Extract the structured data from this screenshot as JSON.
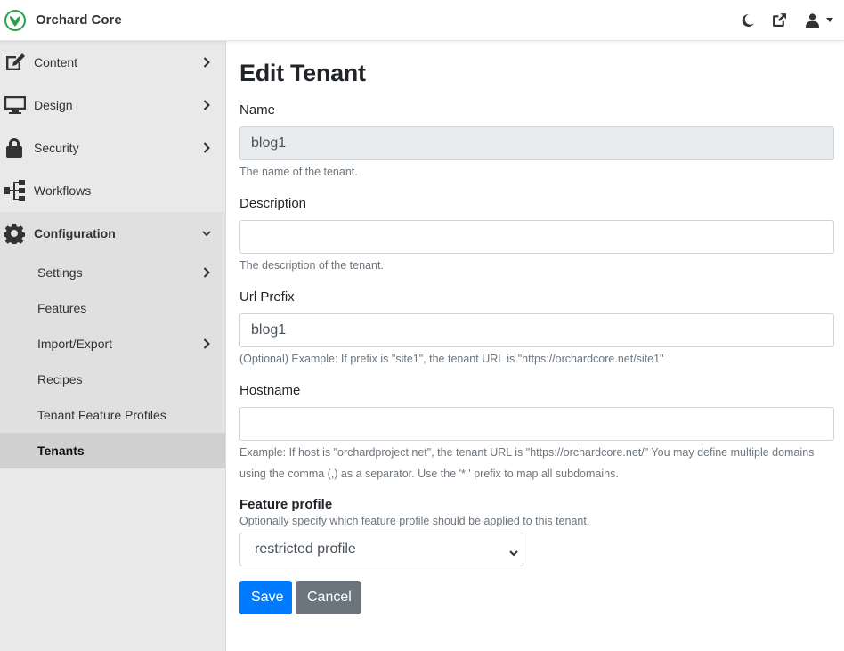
{
  "app": {
    "title": "Orchard Core",
    "brand_color": "#2e9d4e"
  },
  "topbar": {
    "icons": [
      "moon-icon",
      "external-link-icon",
      "user-icon",
      "caret-down-icon"
    ]
  },
  "sidebar": {
    "items": [
      {
        "label": "Content",
        "icon": "edit-icon"
      },
      {
        "label": "Design",
        "icon": "monitor-icon"
      },
      {
        "label": "Security",
        "icon": "lock-icon"
      },
      {
        "label": "Workflows",
        "icon": "sitemap-icon"
      },
      {
        "label": "Configuration",
        "icon": "gear-icon"
      }
    ],
    "configuration_items": [
      {
        "label": "Settings"
      },
      {
        "label": "Features"
      },
      {
        "label": "Import/Export"
      },
      {
        "label": "Recipes"
      },
      {
        "label": "Tenant Feature Profiles"
      },
      {
        "label": "Tenants"
      }
    ]
  },
  "form": {
    "title": "Edit Tenant",
    "name": {
      "label": "Name",
      "value": "blog1",
      "help": "The name of the tenant."
    },
    "description": {
      "label": "Description",
      "value": "",
      "help": "The description of the tenant."
    },
    "url_prefix": {
      "label": "Url Prefix",
      "value": "blog1",
      "help": "(Optional) Example: If prefix is \"site1\", the tenant URL is \"https://orchardcore.net/site1\""
    },
    "hostname": {
      "label": "Hostname",
      "value": "",
      "help_line1": "Example: If host is \"orchardproject.net\", the tenant URL is \"https://orchardcore.net/\" You may define multiple domains",
      "help_line2": "using the comma (,) as a separator. Use the '*.' prefix to map all subdomains."
    },
    "feature_profile": {
      "label": "Feature profile",
      "help": "Optionally specify which feature profile should be applied to this tenant.",
      "selected": "restricted profile"
    },
    "save_label": "Save",
    "cancel_label": "Cancel"
  }
}
